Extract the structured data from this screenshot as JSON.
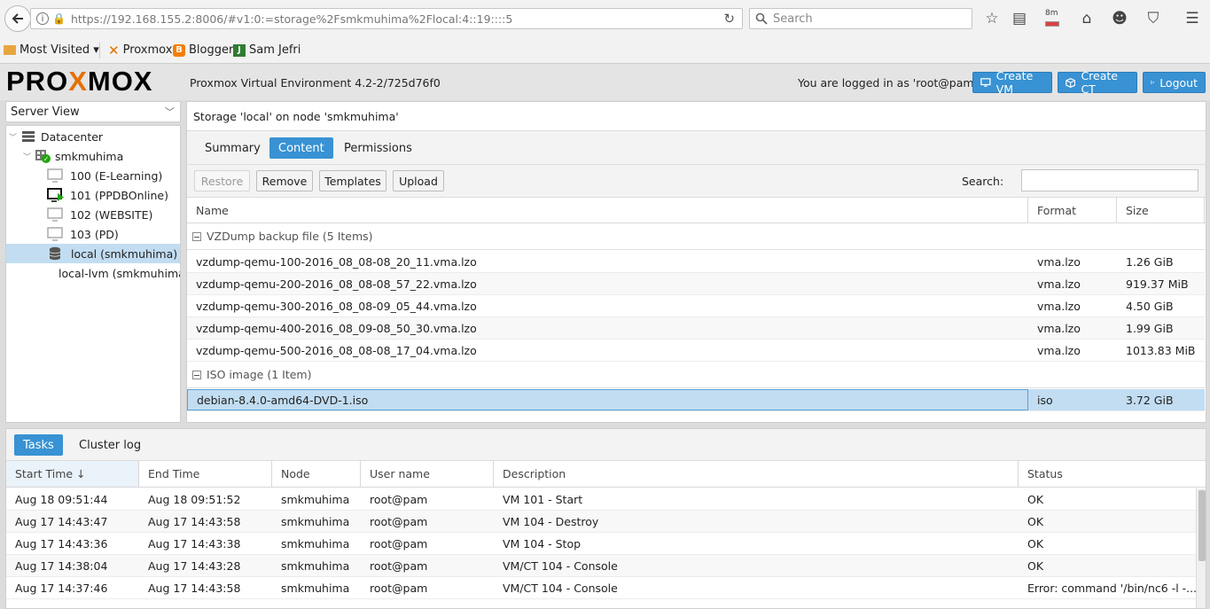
{
  "browser": {
    "url": "https://192.168.155.2:8006/#v1:0:=storage%2Fsmkmuhima%2Flocal:4::19::::5",
    "search_placeholder": "Search",
    "download_badge": "8m",
    "bookmarks": [
      {
        "label": "Most Visited ▾"
      },
      {
        "label": "Proxmox"
      },
      {
        "label": "Blogger"
      },
      {
        "label": "Sam Jefri"
      }
    ]
  },
  "header": {
    "logo_text": "PROXMOX",
    "version": "Proxmox Virtual Environment 4.2-2/725d76f0",
    "login_text": "You are logged in as 'root@pam'",
    "create_vm": "Create VM",
    "create_ct": "Create CT",
    "logout": "Logout"
  },
  "sidebar": {
    "view_selector": "Server View",
    "tree": [
      {
        "label": "Datacenter",
        "icon": "datacenter-icon"
      },
      {
        "label": "smkmuhima",
        "icon": "node-icon"
      },
      {
        "label": "100 (E-Learning)",
        "icon": "vm-icon"
      },
      {
        "label": "101 (PPDBOnline)",
        "icon": "vm-running-icon"
      },
      {
        "label": "102 (WEBSITE)",
        "icon": "vm-icon"
      },
      {
        "label": "103 (PD)",
        "icon": "vm-icon"
      },
      {
        "label": "local (smkmuhima)",
        "icon": "storage-icon"
      },
      {
        "label": "local-lvm (smkmuhima)",
        "icon": "storage-icon"
      }
    ]
  },
  "content": {
    "title": "Storage 'local' on node 'smkmuhima'",
    "tabs": [
      "Summary",
      "Content",
      "Permissions"
    ],
    "buttons": {
      "restore": "Restore",
      "remove": "Remove",
      "templates": "Templates",
      "upload": "Upload"
    },
    "search_label": "Search:",
    "columns": [
      "Name",
      "Format",
      "Size"
    ],
    "groups": [
      {
        "title": "VZDump backup file (5 Items)",
        "rows": [
          {
            "name": "vzdump-qemu-100-2016_08_08-08_20_11.vma.lzo",
            "format": "vma.lzo",
            "size": "1.26 GiB"
          },
          {
            "name": "vzdump-qemu-200-2016_08_08-08_57_22.vma.lzo",
            "format": "vma.lzo",
            "size": "919.37 MiB"
          },
          {
            "name": "vzdump-qemu-300-2016_08_08-09_05_44.vma.lzo",
            "format": "vma.lzo",
            "size": "4.50 GiB"
          },
          {
            "name": "vzdump-qemu-400-2016_08_09-08_50_30.vma.lzo",
            "format": "vma.lzo",
            "size": "1.99 GiB"
          },
          {
            "name": "vzdump-qemu-500-2016_08_08-08_17_04.vma.lzo",
            "format": "vma.lzo",
            "size": "1013.83 MiB"
          }
        ]
      },
      {
        "title": "ISO image (1 Item)",
        "rows": [
          {
            "name": "debian-8.4.0-amd64-DVD-1.iso",
            "format": "iso",
            "size": "3.72 GiB"
          }
        ]
      }
    ]
  },
  "tasks": {
    "tabs": [
      "Tasks",
      "Cluster log"
    ],
    "columns": [
      "Start Time ↓",
      "End Time",
      "Node",
      "User name",
      "Description",
      "Status"
    ],
    "rows": [
      {
        "start": "Aug 18 09:51:44",
        "end": "Aug 18 09:51:52",
        "node": "smkmuhima",
        "user": "root@pam",
        "desc": "VM 101 - Start",
        "status": "OK"
      },
      {
        "start": "Aug 17 14:43:47",
        "end": "Aug 17 14:43:58",
        "node": "smkmuhima",
        "user": "root@pam",
        "desc": "VM 104 - Destroy",
        "status": "OK"
      },
      {
        "start": "Aug 17 14:43:36",
        "end": "Aug 17 14:43:38",
        "node": "smkmuhima",
        "user": "root@pam",
        "desc": "VM 104 - Stop",
        "status": "OK"
      },
      {
        "start": "Aug 17 14:38:04",
        "end": "Aug 17 14:43:28",
        "node": "smkmuhima",
        "user": "root@pam",
        "desc": "VM/CT 104 - Console",
        "status": "OK"
      },
      {
        "start": "Aug 17 14:37:46",
        "end": "Aug 17 14:43:58",
        "node": "smkmuhima",
        "user": "root@pam",
        "desc": "VM/CT 104 - Console",
        "status": "Error: command '/bin/nc6 -l -..."
      }
    ]
  },
  "colors": {
    "accent": "#3892d3",
    "selected_row": "#c2ddf2",
    "logo_x": "#e57000"
  }
}
